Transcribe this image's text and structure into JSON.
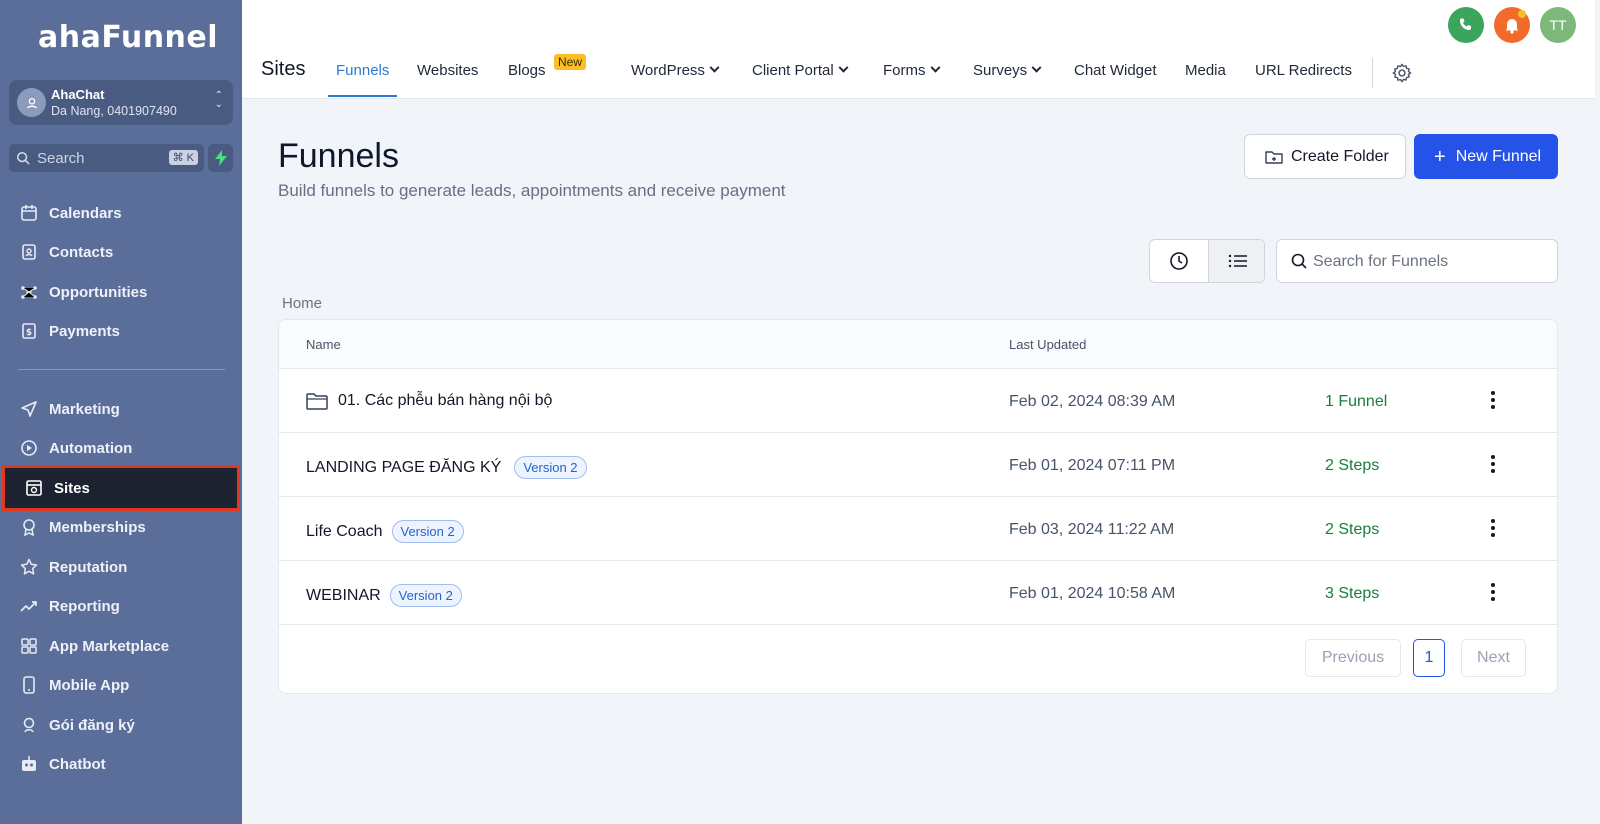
{
  "brand": {
    "logo_text": "ahaFunnel"
  },
  "account": {
    "name": "AhaChat",
    "location": "Da Nang, 0401907490"
  },
  "sidebar_search": {
    "placeholder": "Search",
    "shortcut": "⌘ K"
  },
  "sidebar": {
    "items_top": [
      {
        "label": "Calendars",
        "icon": "calendar-icon"
      },
      {
        "label": "Contacts",
        "icon": "contacts-icon"
      },
      {
        "label": "Opportunities",
        "icon": "opportunities-icon"
      },
      {
        "label": "Payments",
        "icon": "payments-icon"
      }
    ],
    "items_bottom": [
      {
        "label": "Marketing",
        "icon": "send-icon"
      },
      {
        "label": "Automation",
        "icon": "automation-icon"
      },
      {
        "label": "Sites",
        "icon": "sites-icon",
        "active": true
      },
      {
        "label": "Memberships",
        "icon": "award-icon"
      },
      {
        "label": "Reputation",
        "icon": "star-icon"
      },
      {
        "label": "Reporting",
        "icon": "trend-icon"
      },
      {
        "label": "App Marketplace",
        "icon": "grid-icon"
      },
      {
        "label": "Mobile App",
        "icon": "phone-icon"
      },
      {
        "label": "Gói đăng ký",
        "icon": "badge-icon"
      },
      {
        "label": "Chatbot",
        "icon": "bot-icon"
      }
    ]
  },
  "topnav": {
    "section_title": "Sites",
    "tabs": [
      {
        "label": "Funnels",
        "active": true
      },
      {
        "label": "Websites"
      },
      {
        "label": "Blogs",
        "badge": "New"
      },
      {
        "label": "WordPress",
        "dropdown": true
      },
      {
        "label": "Client Portal",
        "dropdown": true
      },
      {
        "label": "Forms",
        "dropdown": true
      },
      {
        "label": "Surveys",
        "dropdown": true
      },
      {
        "label": "Chat Widget"
      },
      {
        "label": "Media"
      },
      {
        "label": "URL Redirects"
      }
    ],
    "user_initials": "TT"
  },
  "page": {
    "title": "Funnels",
    "subtitle": "Build funnels to generate leads, appointments and receive payment",
    "create_folder_label": "Create Folder",
    "new_funnel_label": "New Funnel",
    "search_placeholder": "Search for Funnels",
    "breadcrumb": "Home"
  },
  "table": {
    "columns": {
      "name": "Name",
      "last_updated": "Last Updated"
    },
    "rows": [
      {
        "name": "01. Các phễu bán hàng nội bộ",
        "folder": true,
        "version": "",
        "updated": "Feb 02, 2024 08:39 AM",
        "count": "1 Funnel"
      },
      {
        "name": "LANDING PAGE ĐĂNG KÝ",
        "folder": false,
        "version": "Version 2",
        "updated": "Feb 01, 2024 07:11 PM",
        "count": "2 Steps"
      },
      {
        "name": "Life Coach",
        "folder": false,
        "version": "Version 2",
        "updated": "Feb 03, 2024 11:22 AM",
        "count": "2 Steps"
      },
      {
        "name": "WEBINAR",
        "folder": false,
        "version": "Version 2",
        "updated": "Feb 01, 2024 10:58 AM",
        "count": "3 Steps"
      }
    ]
  },
  "pagination": {
    "previous": "Previous",
    "current": "1",
    "next": "Next"
  },
  "colors": {
    "sidebar": "#5b6e9a",
    "primary": "#2553e8",
    "active_tab": "#2b7bd3",
    "success": "#16803c",
    "highlight": "#e0381f"
  }
}
